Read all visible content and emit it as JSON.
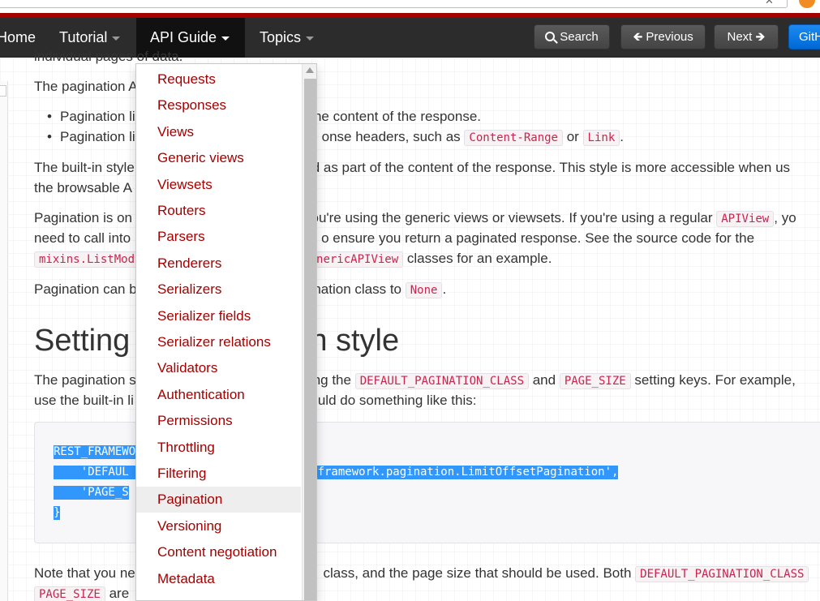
{
  "navbar": {
    "home_label": "Home",
    "tutorial_label": "Tutorial",
    "api_guide_label": "API Guide",
    "topics_label": "Topics",
    "search_label": "Search",
    "previous_label": "Previous",
    "next_label": "Next",
    "github_label": "GitHub"
  },
  "api_guide_menu": {
    "selected": "Pagination",
    "items": [
      "Requests",
      "Responses",
      "Views",
      "Generic views",
      "Viewsets",
      "Routers",
      "Parsers",
      "Renderers",
      "Serializers",
      "Serializer fields",
      "Serializer relations",
      "Validators",
      "Authentication",
      "Permissions",
      "Throttling",
      "Filtering",
      "Pagination",
      "Versioning",
      "Content negotiation",
      "Metadata"
    ]
  },
  "content": {
    "line0": "individual pages of data.",
    "p1": "The pagination A",
    "bullet1_a": "Pagination li",
    "bullet1_b": " of the content of the response.",
    "bullet2_a": "Pagination li",
    "bullet2_b": "onse headers, such as ",
    "code_content_range": "Content-Range",
    "bullet2_or": " or ",
    "code_link": "Link",
    "bullet2_end": ".",
    "p2_line1_a": "The built-in style",
    "p2_line1_b": "ded as part of the content of the response. This style is more accessible when us",
    "p2_line2": "the browsable A",
    "p3_line1_a": "Pagination is on",
    "p3_line1_b": "you're using the generic views or viewsets. If you're using a regular ",
    "code_apiview": "APIView",
    "p3_line1_c": ", yo",
    "p3_line2_a": "need to call into",
    "p3_line2_b": "o ensure you return a paginated response. See the source code for the",
    "code_mixins": "mixins.ListMod",
    "code_generic": "nericAPIView",
    "p3_line3_c": " classes for an example.",
    "p4_a": "Pagination can b",
    "p4_b": "agination class to ",
    "code_none": "None",
    "p4_end": ".",
    "heading_a": "Setting",
    "heading_b": "n style",
    "p5_line1_a": "The pagination s",
    "p5_line1_b": "ng the ",
    "code_default_pagination": "DEFAULT_PAGINATION_CLASS",
    "p5_and": " and ",
    "code_page_size": "PAGE_SIZE",
    "p5_line1_c": " setting keys. For example,",
    "p5_line2_a": "use the built-in li",
    "p5_line2_b": "uld do something like this:",
    "code_line1": "REST_FRAMEWO",
    "code_line2_a": "    'DEFAUL",
    "code_line2_b": "t_framework.pagination.LimitOffsetPagination',",
    "code_line3": "    'PAGE_S",
    "code_line4": "}",
    "p6_a": "Note that you ne",
    "p6_b": " class, and the page size that should be used. Both ",
    "code_default_pagination_2": "DEFAULT_PAGINATION_CLASS",
    "code_page_size_2": "PAGE_SIZE",
    "p6_line2": " are"
  }
}
